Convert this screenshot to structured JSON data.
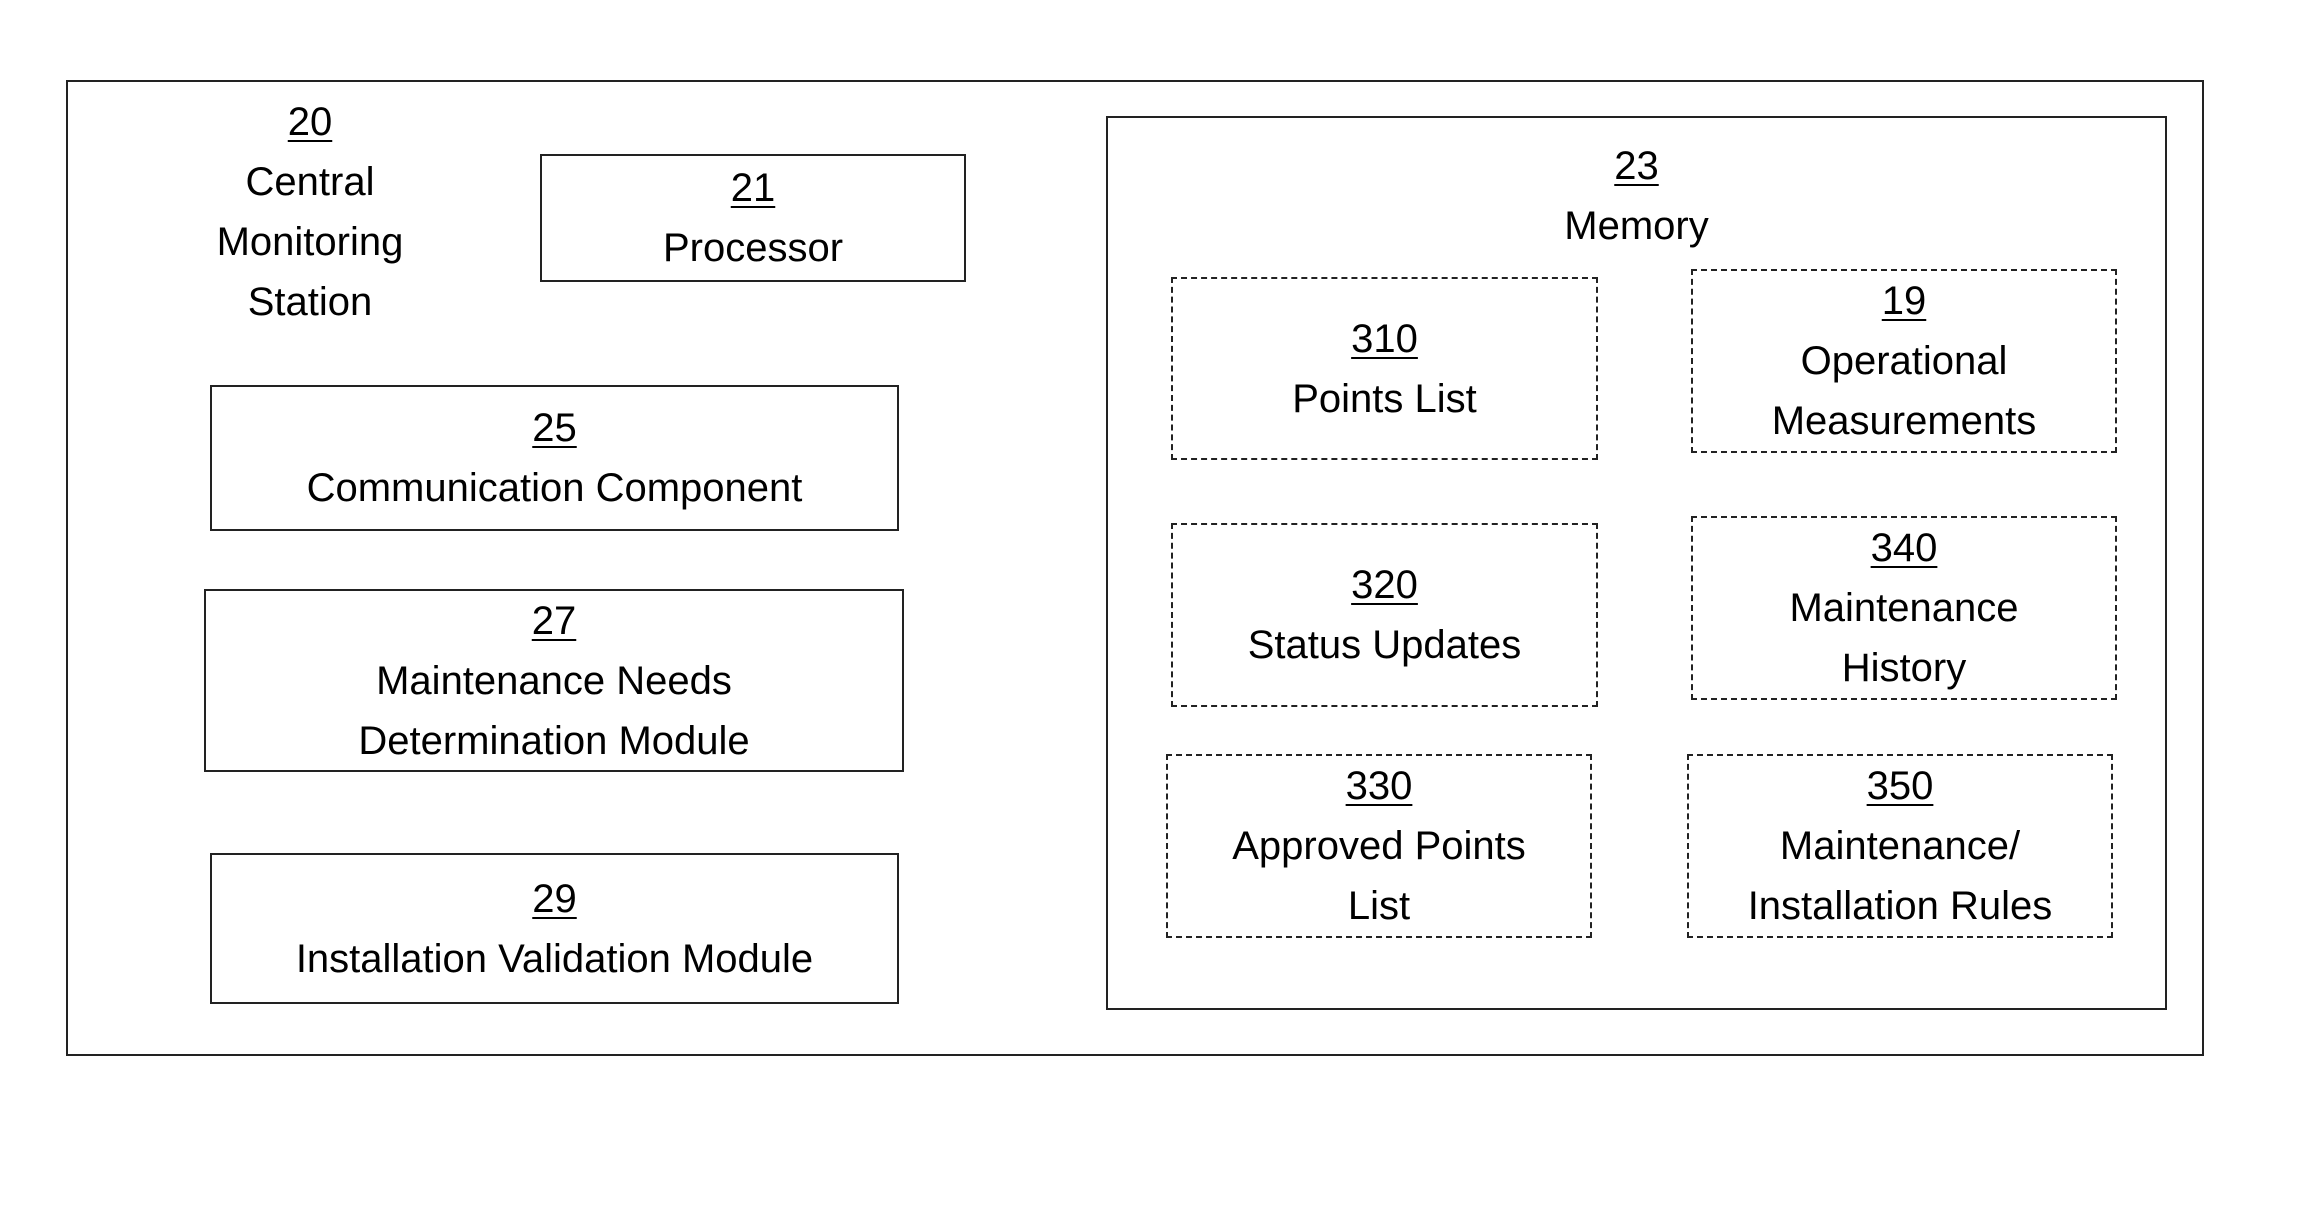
{
  "diagram": {
    "station": {
      "ref": "20",
      "lines": [
        "Central",
        "Monitoring",
        "Station"
      ]
    },
    "components": [
      {
        "id": "processor",
        "ref": "21",
        "lines": [
          "Processor"
        ]
      },
      {
        "id": "communication-component",
        "ref": "25",
        "lines": [
          "Communication Component"
        ]
      },
      {
        "id": "maintenance-needs-module",
        "ref": "27",
        "lines": [
          "Maintenance Needs",
          "Determination Module"
        ]
      },
      {
        "id": "installation-validation-module",
        "ref": "29",
        "lines": [
          "Installation Validation Module"
        ]
      }
    ],
    "memory": {
      "ref": "23",
      "label": "Memory",
      "items": [
        {
          "id": "points-list",
          "ref": "310",
          "lines": [
            "Points List"
          ]
        },
        {
          "id": "operational-measurements",
          "ref": "19",
          "lines": [
            "Operational",
            "Measurements"
          ]
        },
        {
          "id": "status-updates",
          "ref": "320",
          "lines": [
            "Status Updates"
          ]
        },
        {
          "id": "maintenance-history",
          "ref": "340",
          "lines": [
            "Maintenance",
            "History"
          ]
        },
        {
          "id": "approved-points-list",
          "ref": "330",
          "lines": [
            "Approved Points",
            "List"
          ]
        },
        {
          "id": "maintenance-installation-rules",
          "ref": "350",
          "lines": [
            "Maintenance/",
            "Installation Rules"
          ]
        }
      ]
    }
  }
}
